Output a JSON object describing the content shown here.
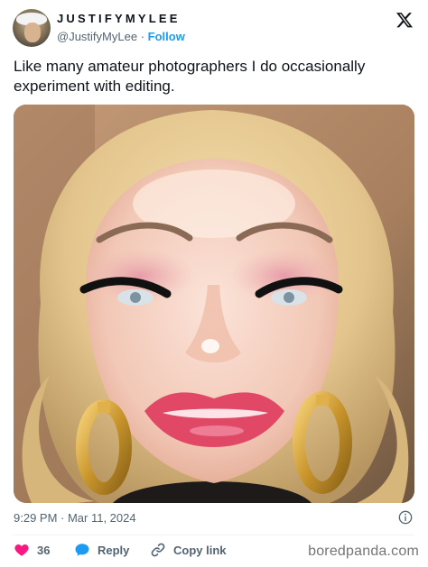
{
  "author": {
    "display_name": "JUSTIFYMYLEE",
    "handle": "@JustifyMyLee",
    "separator": "·",
    "follow_label": "Follow"
  },
  "tweet": {
    "text": "Like many amateur photographers I do occasionally experiment with editing.",
    "timestamp": "9:29 PM · Mar 11, 2024"
  },
  "actions": {
    "likes_count": "36",
    "reply_label": "Reply",
    "copy_link_label": "Copy link"
  },
  "watermark": "boredpanda.com",
  "colors": {
    "accent": "#1d9bf0",
    "like": "#f91880",
    "muted_text": "#536471",
    "text": "#0f1419"
  },
  "icons": {
    "brand": "x-logo-icon",
    "info": "info-icon",
    "like": "heart-icon",
    "reply": "speech-bubble-icon",
    "copy": "link-icon"
  }
}
